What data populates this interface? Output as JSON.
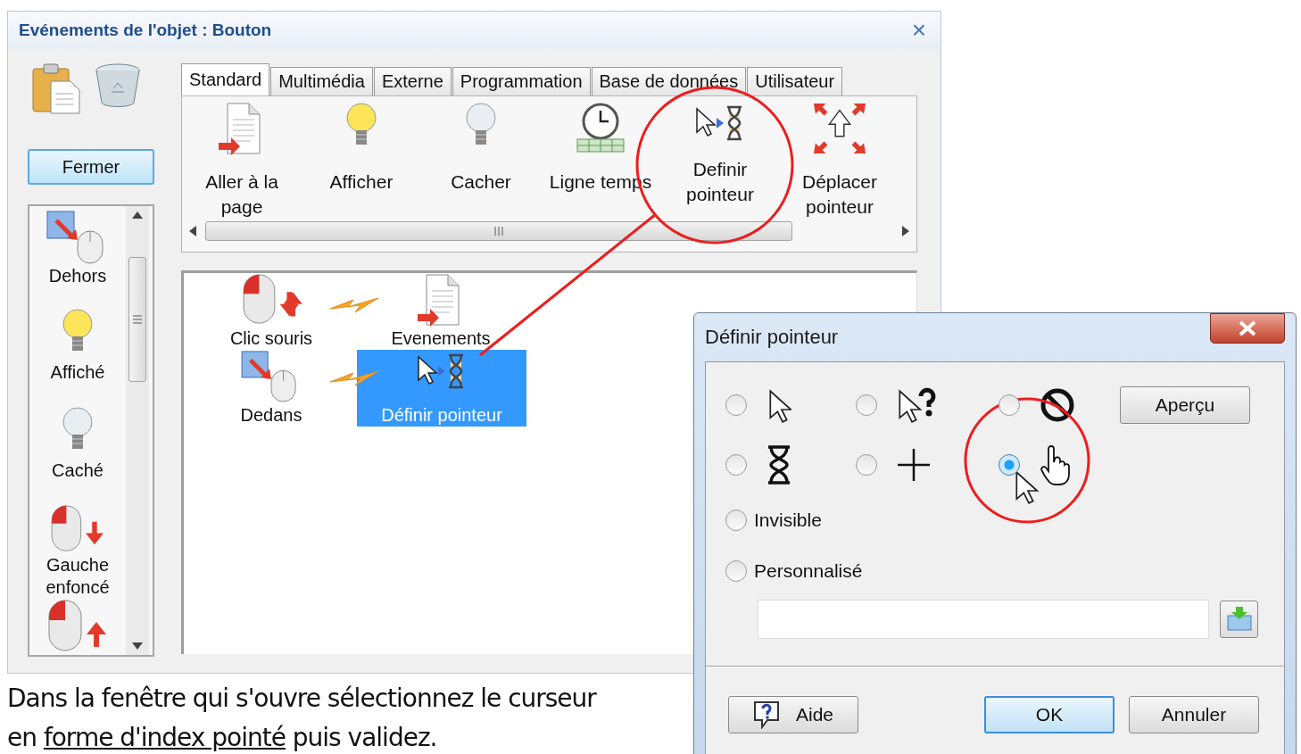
{
  "main_window": {
    "title": "Evénements de l'objet : Bouton",
    "close": "×"
  },
  "fermer_button": "Fermer",
  "event_list": [
    {
      "label": "Dehors"
    },
    {
      "label": "Affiché"
    },
    {
      "label": "Caché"
    },
    {
      "label": "Gauche enfoncé"
    }
  ],
  "tabs": [
    {
      "label": "Standard",
      "selected": true
    },
    {
      "label": "Multimédia",
      "selected": false
    },
    {
      "label": "Externe",
      "selected": false
    },
    {
      "label": "Programmation",
      "selected": false
    },
    {
      "label": "Base de données",
      "selected": false
    },
    {
      "label": "Utilisateur",
      "selected": false
    }
  ],
  "actions": [
    {
      "label": "Aller à la page"
    },
    {
      "label": "Afficher"
    },
    {
      "label": "Cacher"
    },
    {
      "label": "Ligne temps"
    },
    {
      "label": "Definir pointeur"
    },
    {
      "label": "Déplacer pointeur"
    }
  ],
  "canvas_nodes": [
    {
      "label": "Clic souris",
      "selected": false
    },
    {
      "label": "Evenements",
      "selected": false
    },
    {
      "label": "Dedans",
      "selected": false
    },
    {
      "label": "Définir pointeur",
      "selected": true
    }
  ],
  "caption": {
    "before": "Dans la fenêtre qui s'ouvre sélectionnez le curseur en ",
    "underlined": "forme d'index pointé",
    "after": " puis validez."
  },
  "dialog": {
    "title": "Définir pointeur",
    "pointer_options": [
      {
        "selected": false
      },
      {
        "selected": false
      },
      {
        "selected": false
      },
      {
        "selected": false
      },
      {
        "selected": false
      },
      {
        "selected": true
      }
    ],
    "text_options": [
      {
        "label": "Invisible",
        "selected": false
      },
      {
        "label": "Personnalisé",
        "selected": false
      }
    ],
    "preview_button": "Aperçu",
    "help_button": "Aide",
    "ok_button": "OK",
    "cancel_button": "Annuler"
  }
}
